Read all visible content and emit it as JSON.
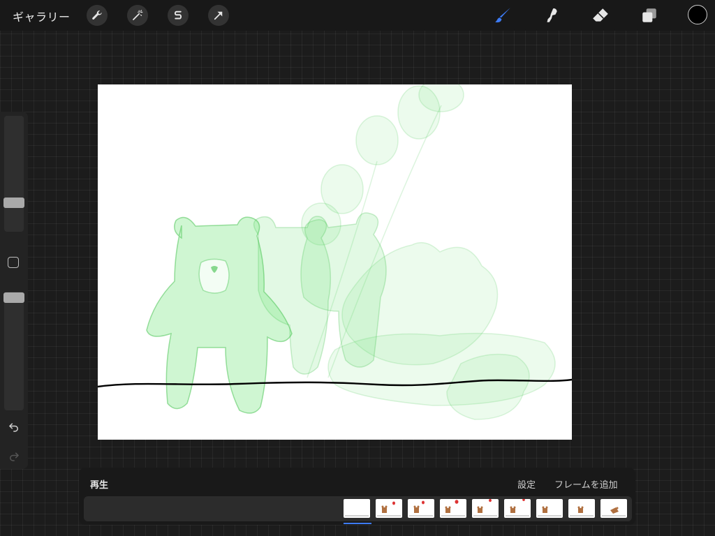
{
  "toolbar": {
    "gallery_label": "ギャラリー",
    "left_tools": [
      "wrench-icon",
      "magic-wand-icon",
      "selection-icon",
      "transform-arrow-icon"
    ],
    "right_tools": [
      "brush-icon",
      "smudge-icon",
      "eraser-icon",
      "layers-icon"
    ],
    "active_tool": "brush-icon",
    "accent_color": "#3d7bf5",
    "current_color": "#000000"
  },
  "sidebar": {
    "brush_size_level": 0.75,
    "opacity_level": 0.94,
    "controls": [
      "modify-button",
      "undo-icon",
      "redo-icon"
    ]
  },
  "canvas": {
    "background": "#ffffff",
    "onion_skin_color": "#5fe06a"
  },
  "animation": {
    "play_label": "再生",
    "settings_label": "設定",
    "add_frame_label": "フレームを追加",
    "frame_count": 9,
    "selected_frame": 1
  }
}
